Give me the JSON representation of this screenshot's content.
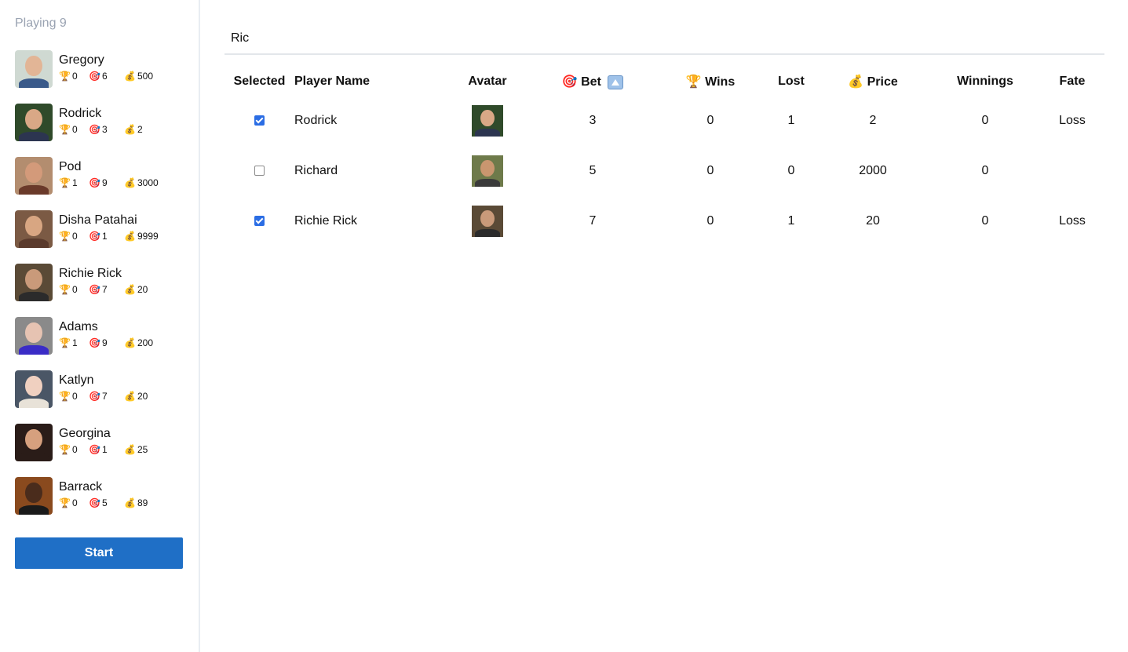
{
  "sidebar": {
    "title": "Playing 9",
    "players": [
      {
        "name": "Gregory",
        "wins": "0",
        "bet": "6",
        "price": "500",
        "bg": "#cfd9d2",
        "skin": "#e2b596",
        "shirt": "#3a5a8a"
      },
      {
        "name": "Rodrick",
        "wins": "0",
        "bet": "3",
        "price": "2",
        "bg": "#2f4a2a",
        "skin": "#d9a886",
        "shirt": "#2c3550"
      },
      {
        "name": "Pod",
        "wins": "1",
        "bet": "9",
        "price": "3000",
        "bg": "#b38d6f",
        "skin": "#d39a7a",
        "shirt": "#6a3a2a"
      },
      {
        "name": "Disha Patahai",
        "wins": "0",
        "bet": "1",
        "price": "9999",
        "bg": "#7b5a44",
        "skin": "#d8a682",
        "shirt": "#5a3a2c"
      },
      {
        "name": "Richie Rick",
        "wins": "0",
        "bet": "7",
        "price": "20",
        "bg": "#5a4a36",
        "skin": "#c99a7a",
        "shirt": "#2b2b2b"
      },
      {
        "name": "Adams",
        "wins": "1",
        "bet": "9",
        "price": "200",
        "bg": "#8a8a8a",
        "skin": "#e6c3b2",
        "shirt": "#3a2cc6"
      },
      {
        "name": "Katlyn",
        "wins": "0",
        "bet": "7",
        "price": "20",
        "bg": "#4a5666",
        "skin": "#f0d0c0",
        "shirt": "#e8e2d8"
      },
      {
        "name": "Georgina",
        "wins": "0",
        "bet": "1",
        "price": "25",
        "bg": "#2a1c18",
        "skin": "#d6a07e",
        "shirt": "#2a1c18"
      },
      {
        "name": "Barrack",
        "wins": "0",
        "bet": "5",
        "price": "89",
        "bg": "#8a4a1e",
        "skin": "#4a2c1c",
        "shirt": "#1a1a1a"
      }
    ],
    "start_label": "Start"
  },
  "search": {
    "value": "Ric"
  },
  "table": {
    "headers": {
      "selected": "Selected",
      "player_name": "Player Name",
      "avatar": "Avatar",
      "bet": "Bet",
      "wins": "Wins",
      "lost": "Lost",
      "price": "Price",
      "winnings": "Winnings",
      "fate": "Fate"
    },
    "rows": [
      {
        "selected": true,
        "name": "Rodrick",
        "bet": "3",
        "wins": "0",
        "lost": "1",
        "price": "2",
        "winnings": "0",
        "fate": "Loss",
        "bg": "#2f4a2a",
        "skin": "#d9a886",
        "shirt": "#2c3550"
      },
      {
        "selected": false,
        "name": "Richard",
        "bet": "5",
        "wins": "0",
        "lost": "0",
        "price": "2000",
        "winnings": "0",
        "fate": "",
        "bg": "#6e7a4a",
        "skin": "#c9966f",
        "shirt": "#3a3a3a"
      },
      {
        "selected": true,
        "name": "Richie Rick",
        "bet": "7",
        "wins": "0",
        "lost": "1",
        "price": "20",
        "winnings": "0",
        "fate": "Loss",
        "bg": "#5a4a36",
        "skin": "#c99a7a",
        "shirt": "#2b2b2b"
      }
    ]
  },
  "icons": {
    "trophy": "🏆",
    "target": "🎯",
    "money": "💰"
  },
  "colors": {
    "start_button": "#1f6fc6",
    "checkbox": "#2b6de4",
    "sidebar_title": "#9aa3b2"
  }
}
